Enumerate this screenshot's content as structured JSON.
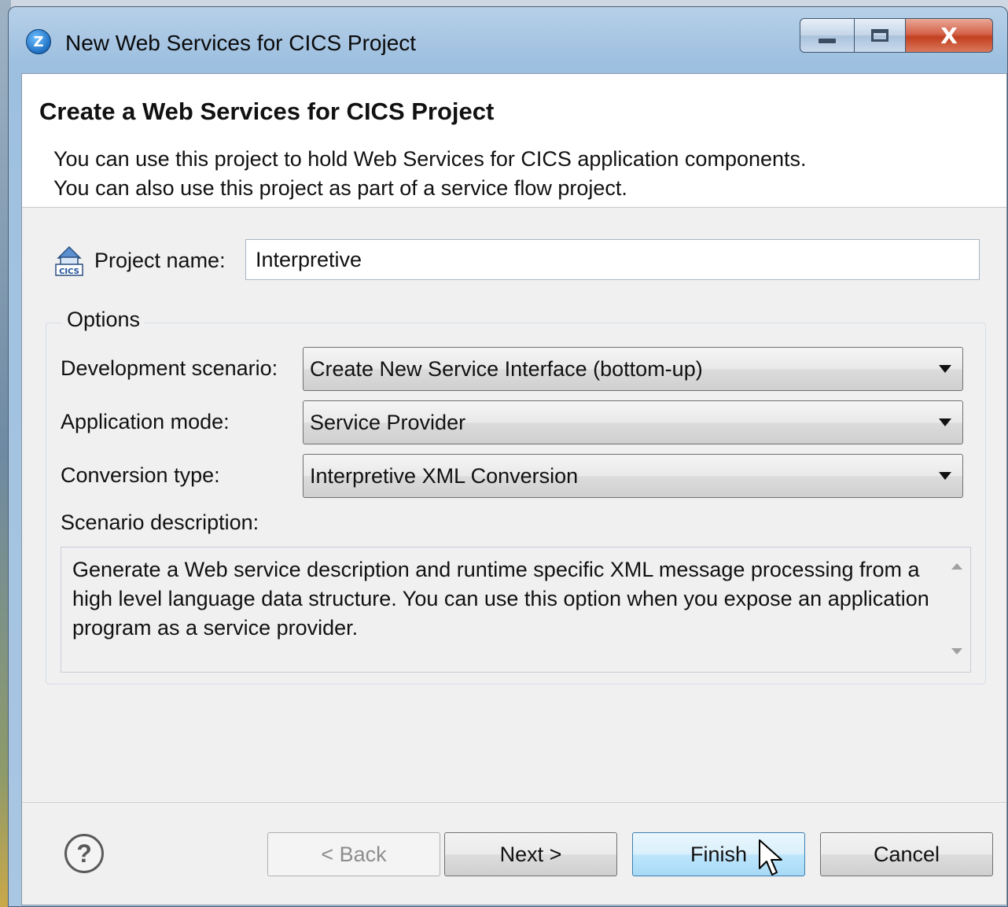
{
  "window": {
    "title": "New Web Services for CICS Project",
    "close_glyph": "X"
  },
  "header": {
    "title": "Create a Web Services for CICS Project",
    "description_lines": [
      "You can use this project to hold Web Services for CICS application components.",
      "You can also use this project as part of a service flow project."
    ]
  },
  "project": {
    "label": "Project name:",
    "value": "Interpretive"
  },
  "options": {
    "legend": "Options",
    "development_scenario": {
      "label": "Development scenario:",
      "value": "Create New Service Interface (bottom-up)"
    },
    "application_mode": {
      "label": "Application mode:",
      "value": "Service Provider"
    },
    "conversion_type": {
      "label": "Conversion type:",
      "value": "Interpretive XML Conversion"
    },
    "scenario_description": {
      "label": "Scenario description:",
      "text": "Generate a Web service description and runtime specific XML message processing from a high level language data structure. You can use this option when you expose an application program as a service provider."
    }
  },
  "buttons": {
    "help": "?",
    "back": "< Back",
    "next": "Next >",
    "finish": "Finish",
    "cancel": "Cancel"
  },
  "icons": {
    "app": "eclipse-ide-icon",
    "project": "cics-project-icon",
    "cursor": "mouse-pointer-icon"
  },
  "colors": {
    "default_button_border": "#3c7fb1",
    "close_button": "#c2401f"
  }
}
